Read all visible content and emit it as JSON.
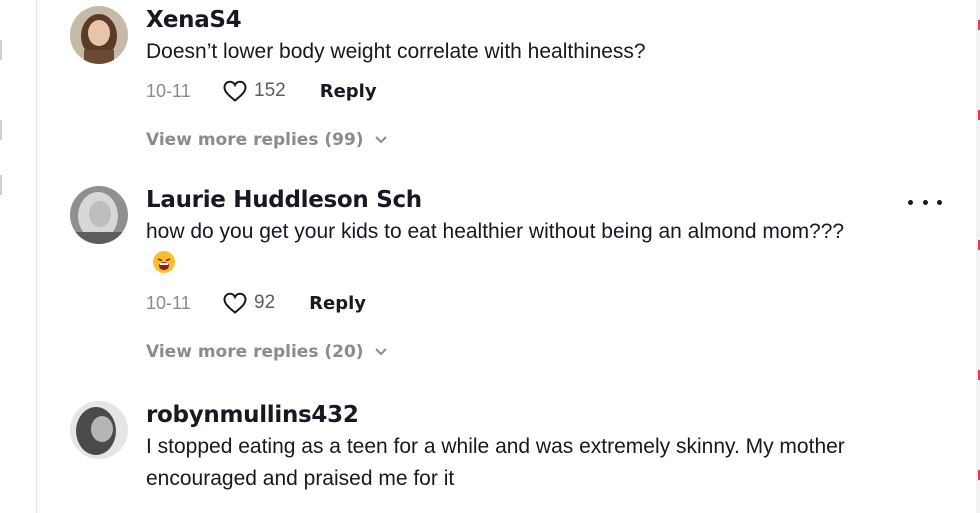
{
  "comments": [
    {
      "username": "XenaS4",
      "text": "Doesn’t lower body weight correlate with healthiness?",
      "date": "10-11",
      "likes": "152",
      "reply_label": "Reply",
      "view_more": "View more replies (99)"
    },
    {
      "username": "Laurie Huddleson Sch",
      "text": "how do you get your kids to eat healthier without being an almond mom???",
      "date": "10-11",
      "likes": "92",
      "reply_label": "Reply",
      "view_more": "View more replies (20)"
    },
    {
      "username": "robynmullins432",
      "text": "I stopped eating as a teen for a while and was extremely skinny. My mother encouraged and praised me for it"
    }
  ],
  "icons": {
    "like": "heart-outline-icon",
    "more": "more-options-icon",
    "expand": "chevron-down-icon",
    "emoji": "face-emoji-icon"
  },
  "colors": {
    "text": "#161823",
    "muted": "#8a8b91",
    "accent": "#fe2c55"
  }
}
